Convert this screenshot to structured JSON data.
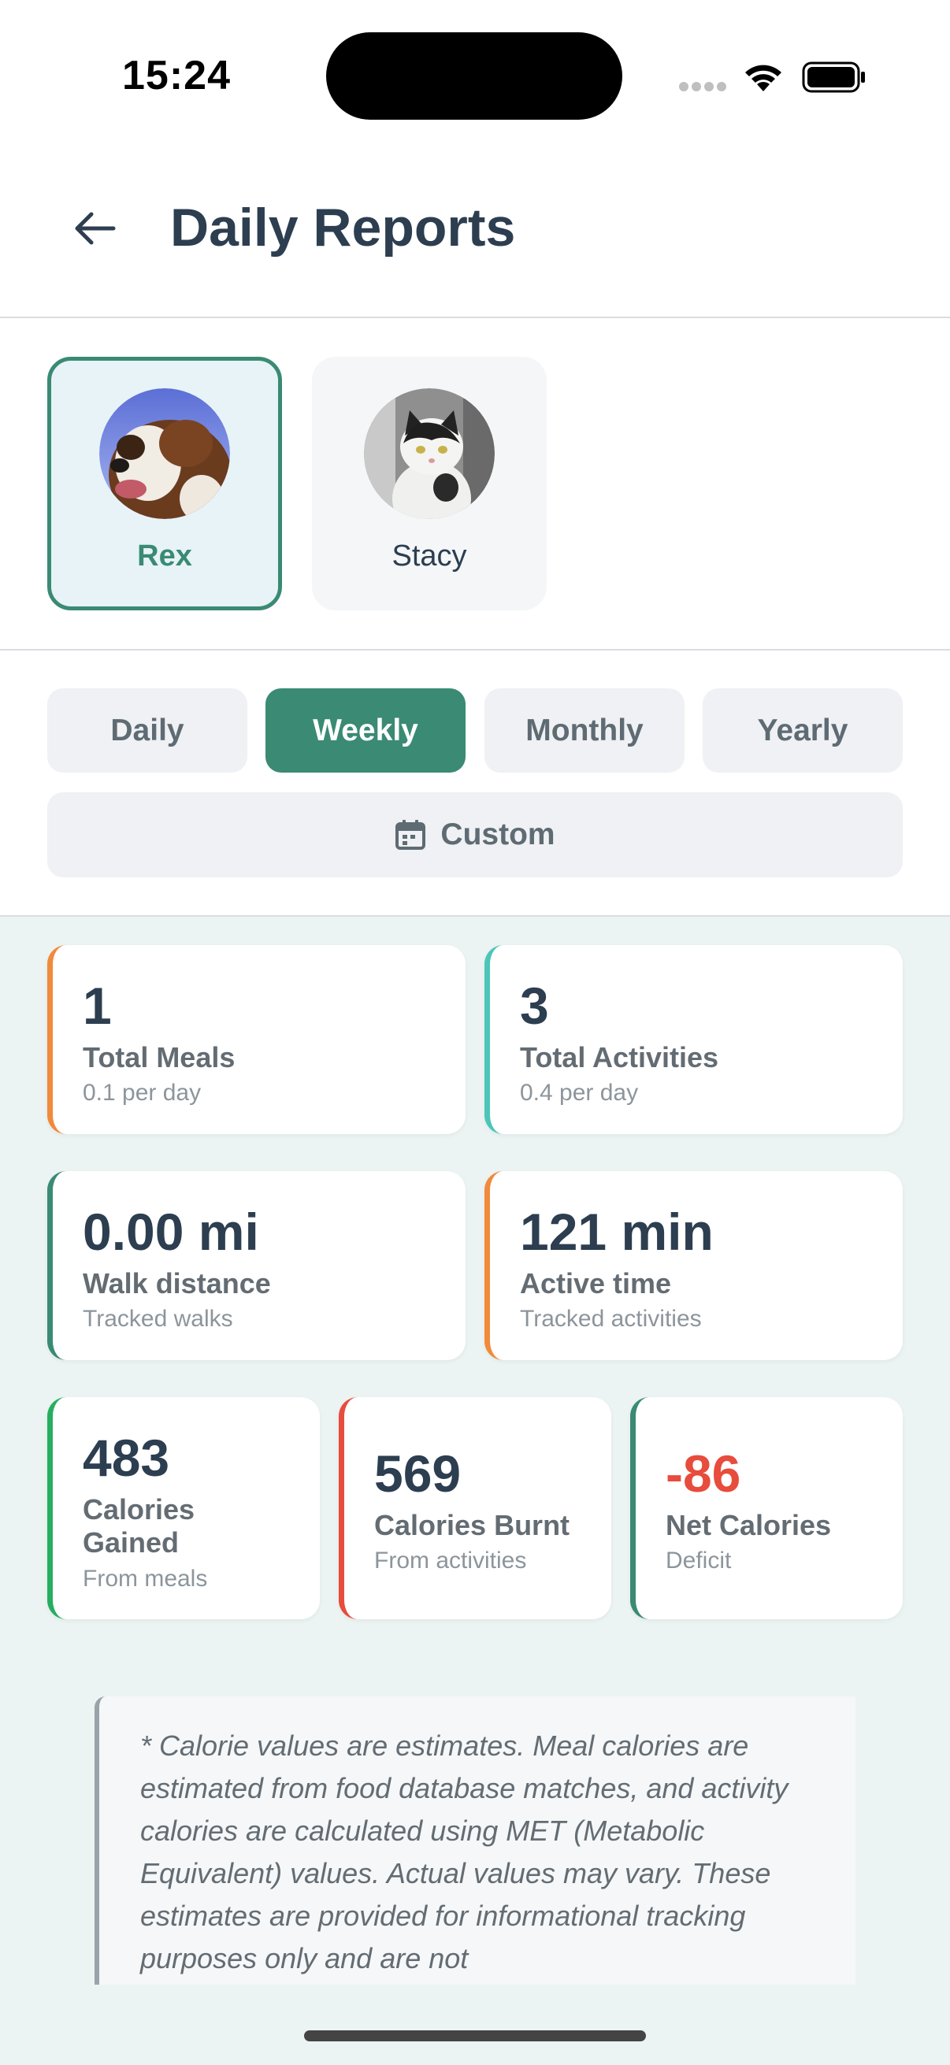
{
  "status_bar": {
    "time": "15:24"
  },
  "header": {
    "title": "Daily Reports"
  },
  "pets": [
    {
      "name": "Rex",
      "selected": true
    },
    {
      "name": "Stacy",
      "selected": false
    }
  ],
  "ranges": [
    {
      "label": "Daily",
      "active": false
    },
    {
      "label": "Weekly",
      "active": true
    },
    {
      "label": "Monthly",
      "active": false
    },
    {
      "label": "Yearly",
      "active": false
    }
  ],
  "custom_label": "Custom",
  "stats": {
    "total_meals": {
      "value": "1",
      "label": "Total Meals",
      "sub": "0.1 per day",
      "accent": "#f08a3c"
    },
    "total_activities": {
      "value": "3",
      "label": "Total Activities",
      "sub": "0.4 per day",
      "accent": "#4bc6b9"
    },
    "walk_distance": {
      "value": "0.00 mi",
      "label": "Walk distance",
      "sub": "Tracked walks",
      "accent": "#3a8a74"
    },
    "active_time": {
      "value": "121 min",
      "label": "Active time",
      "sub": "Tracked activities",
      "accent": "#f08a3c"
    },
    "calories_gained": {
      "value": "483",
      "label": "Calories Gained",
      "sub": "From meals",
      "accent": "#27ae60"
    },
    "calories_burnt": {
      "value": "569",
      "label": "Calories Burnt",
      "sub": "From activities",
      "accent": "#e74c3c"
    },
    "net_calories": {
      "value": "-86",
      "label": "Net Calories",
      "sub": "Deficit",
      "accent": "#3a8a74",
      "value_color": "#e74c3c"
    }
  },
  "disclaimer": "* Calorie values are estimates. Meal calories are estimated from food database matches, and activity calories are calculated using MET (Metabolic Equivalent) values. Actual values may vary. These estimates are provided for informational tracking purposes only and are not",
  "colors": {
    "brand": "#3a8a74",
    "negative": "#e74c3c",
    "text_dark": "#2c3e50"
  }
}
